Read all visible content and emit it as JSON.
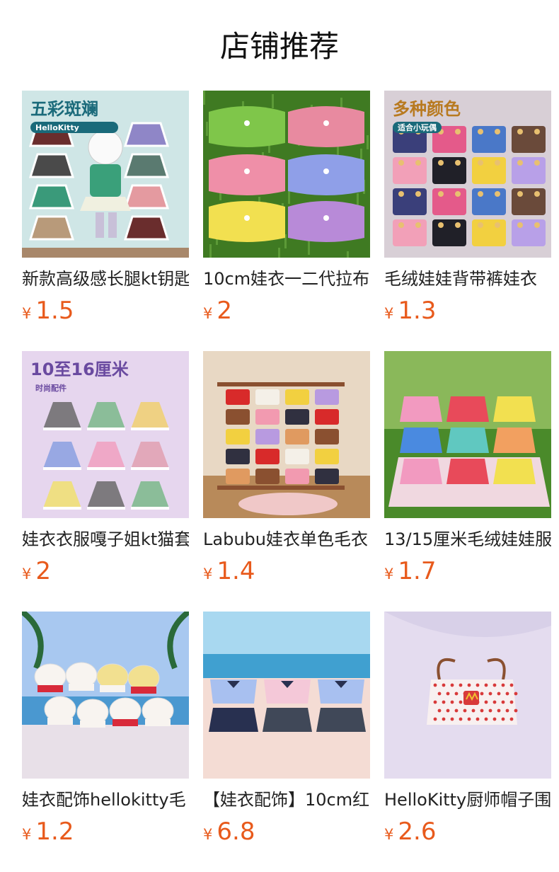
{
  "section": {
    "title": "店铺推荐"
  },
  "currency": "¥",
  "products": [
    {
      "title": "新款高级感长腿kt钥匙",
      "price": "1.5",
      "image": {
        "icon": "doll-skirts-image",
        "banner": "五彩斑斓",
        "tag": "HelloKitty",
        "bg": "#cfe6e6",
        "colors": [
          "#6a2d2d",
          "#8f86c7",
          "#4a4a4a",
          "#5a7a70",
          "#3a9a7a",
          "#e49aa0",
          "#b89a7a"
        ]
      }
    },
    {
      "title": "10cm娃衣一二代拉布",
      "price": "2",
      "image": {
        "icon": "knit-sweaters-image",
        "banner": "",
        "tag": "",
        "bg": "#4d8a2a",
        "colors": [
          "#7fc64a",
          "#e88aa0",
          "#ef8fa8",
          "#8f9fe8",
          "#f2e050",
          "#b88ad8"
        ]
      }
    },
    {
      "title": "毛绒娃娃背带裤娃衣",
      "price": "1.3",
      "image": {
        "icon": "overalls-image",
        "banner": "多种颜色",
        "tag": "适合小玩偶",
        "bg": "#d8cfd6",
        "colors": [
          "#3a3f7a",
          "#e45a8a",
          "#4a78c8",
          "#6a4a3a",
          "#f2a0b8",
          "#202028",
          "#f2d040",
          "#b8a0e8"
        ]
      }
    },
    {
      "title": "娃衣衣服嘎子姐kt猫套",
      "price": "2",
      "image": {
        "icon": "plaid-dresses-image",
        "banner": "10至16厘米",
        "tag": "时尚配件",
        "bg": "#e6d6ee",
        "colors": [
          "#6a6a6a",
          "#7ab88a",
          "#f0d070",
          "#8aa0e0",
          "#f0a0c0",
          "#e0a0b0",
          "#f0e070"
        ]
      }
    },
    {
      "title": "Labubu娃衣单色毛衣",
      "price": "1.4",
      "image": {
        "icon": "sweater-rack-image",
        "banner": "",
        "tag": "",
        "bg": "#e8d8c4",
        "colors": [
          "#d82a2a",
          "#f4f0e8",
          "#f2d040",
          "#b89ae0",
          "#e09a60",
          "#8a5030",
          "#f29ab0",
          "#303040"
        ]
      }
    },
    {
      "title": "13/15厘米毛绒娃娃服",
      "price": "1.7",
      "image": {
        "icon": "summer-dresses-image",
        "banner": "",
        "tag": "",
        "bg": "#5a9a3a",
        "colors": [
          "#f29ac0",
          "#e84a5a",
          "#f2e050",
          "#4a8ae0",
          "#60c8c0",
          "#f2a060"
        ]
      }
    },
    {
      "title": "娃衣配饰hellokitty毛",
      "price": "1.2",
      "image": {
        "icon": "chef-hats-image",
        "banner": "",
        "tag": "",
        "bg": "#8ab8e0",
        "colors": [
          "#f8f4f0",
          "#f2e090",
          "#d82a3a",
          "#303030"
        ]
      }
    },
    {
      "title": "【娃衣配饰】10cm红",
      "price": "6.8",
      "image": {
        "icon": "school-uniforms-image",
        "banner": "",
        "tag": "",
        "bg": "#f0d8d0",
        "colors": [
          "#a8c0f0",
          "#f4c8d8",
          "#283050",
          "#404858"
        ]
      }
    },
    {
      "title": "HelloKitty厨师帽子围",
      "price": "2.6",
      "image": {
        "icon": "apron-image",
        "banner": "",
        "tag": "",
        "bg": "#d8d0e8",
        "colors": [
          "#f8f0f0",
          "#d83a3a",
          "#f2c030",
          "#8a5030"
        ]
      }
    }
  ]
}
